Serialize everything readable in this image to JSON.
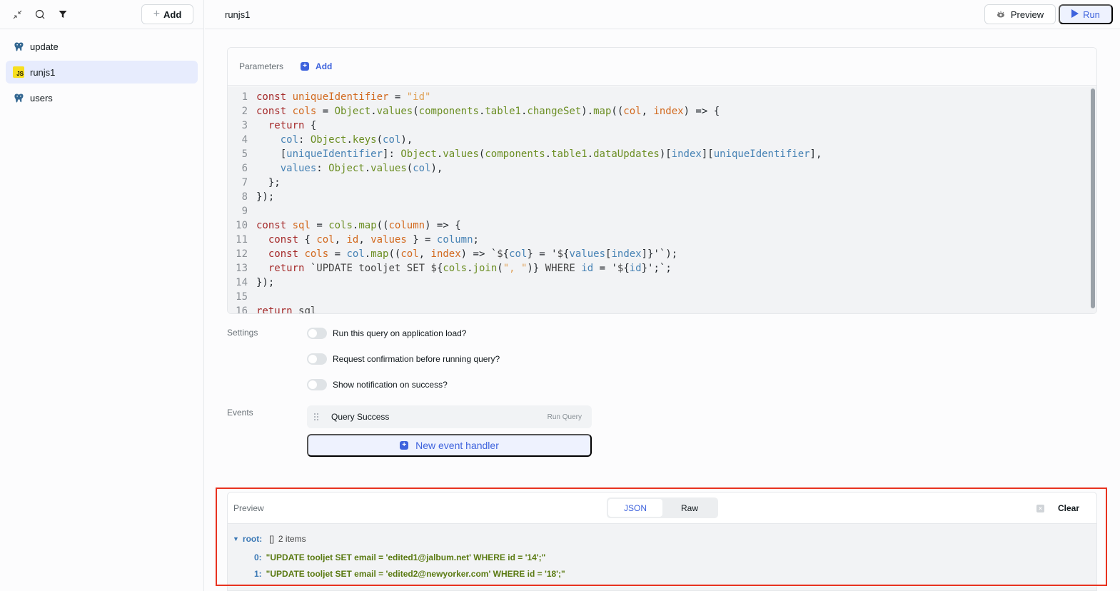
{
  "sidebar": {
    "toolbar": {
      "collapse_icon": "collapse-icon",
      "search_icon": "search-icon",
      "filter_icon": "filter-icon",
      "add_label": "Add"
    },
    "queries": [
      {
        "label": "update",
        "icon": "postgresql-icon",
        "active": false
      },
      {
        "label": "runjs1",
        "icon": "javascript-icon",
        "active": true
      },
      {
        "label": "users",
        "icon": "postgresql-icon",
        "active": false
      }
    ]
  },
  "header": {
    "title": "runjs1",
    "preview_label": "Preview",
    "run_label": "Run"
  },
  "editor": {
    "parameters_label": "Parameters",
    "add_label": "Add",
    "code_lines": [
      "const uniqueIdentifier = \"id\"",
      "const cols = Object.values(components.table1.changeSet).map((col, index) => {",
      "  return {",
      "    col: Object.keys(col),",
      "    [uniqueIdentifier]: Object.values(components.table1.dataUpdates)[index][uniqueIdentifier],",
      "    values: Object.values(col),",
      "  };",
      "});",
      "",
      "const sql = cols.map((column) => {",
      "  const { col, id, values } = column;",
      "  const cols = col.map((col, index) => `${col} = '${values[index]}'`);",
      "  return `UPDATE tooljet SET ${cols.join(\", \")} WHERE id = '${id}';`;",
      "});",
      "",
      "return sql"
    ]
  },
  "settings": {
    "label": "Settings",
    "toggles": [
      {
        "label": "Run this query on application load?",
        "on": false
      },
      {
        "label": "Request confirmation before running query?",
        "on": false
      },
      {
        "label": "Show notification on success?",
        "on": false
      }
    ]
  },
  "events": {
    "label": "Events",
    "handlers": [
      {
        "event": "Query Success",
        "action": "Run Query"
      }
    ],
    "new_handler_label": "New event handler"
  },
  "preview": {
    "label": "Preview",
    "tabs": [
      {
        "label": "JSON",
        "active": true
      },
      {
        "label": "Raw",
        "active": false
      }
    ],
    "clear_label": "Clear",
    "root_key": "root:",
    "root_type": "[]",
    "root_count": "2 items",
    "items": [
      {
        "index": "0:",
        "value": "\"UPDATE tooljet SET email = 'edited1@jalbum.net' WHERE id = '14';\""
      },
      {
        "index": "1:",
        "value": "\"UPDATE tooljet SET email = 'edited2@newyorker.com' WHERE id = '18';\""
      }
    ]
  },
  "colors": {
    "accent": "#3e63dd",
    "active_item_bg": "#e7ecfd",
    "highlight_outline": "#e8321f",
    "js_badge": "#f7df1e"
  }
}
